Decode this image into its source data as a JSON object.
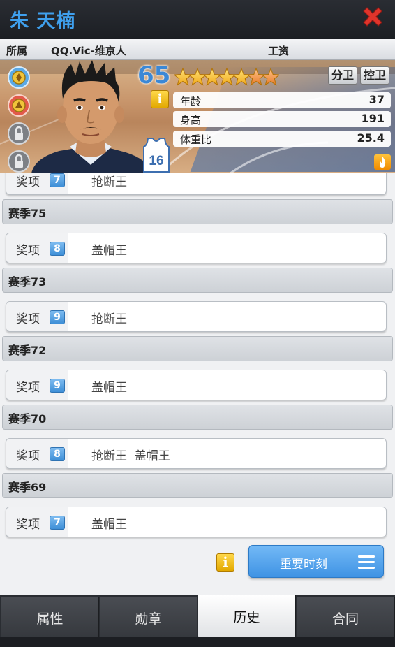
{
  "header": {
    "title": "朱 天楠"
  },
  "info_row": {
    "team_label": "所属",
    "team_value": "QQ.Vic-维京人",
    "salary_label": "工资"
  },
  "player": {
    "overall": "65",
    "stars": 5.5,
    "stars_max": 7,
    "positions": [
      "分卫",
      "控卫"
    ],
    "jersey_number": "16",
    "stats": [
      {
        "label": "年龄",
        "value": "37"
      },
      {
        "label": "身高",
        "value": "191"
      },
      {
        "label": "体重比",
        "value": "25.4"
      }
    ]
  },
  "history": {
    "award_label": "奖项",
    "rows": [
      {
        "kind": "award",
        "count": "7",
        "names": "抢断王"
      },
      {
        "kind": "season",
        "label": "赛季75"
      },
      {
        "kind": "award",
        "count": "8",
        "names": "盖帽王"
      },
      {
        "kind": "season",
        "label": "赛季73"
      },
      {
        "kind": "award",
        "count": "9",
        "names": "抢断王"
      },
      {
        "kind": "season",
        "label": "赛季72"
      },
      {
        "kind": "award",
        "count": "9",
        "names": "盖帽王"
      },
      {
        "kind": "season",
        "label": "赛季70"
      },
      {
        "kind": "award",
        "count": "8",
        "names": "抢断王  盖帽王"
      },
      {
        "kind": "season",
        "label": "赛季69"
      },
      {
        "kind": "award",
        "count": "7",
        "names": "盖帽王"
      }
    ]
  },
  "info_icon": "i",
  "important_button": {
    "label": "重要时刻"
  },
  "tabs": [
    {
      "label": "属性",
      "active": false
    },
    {
      "label": "勋章",
      "active": false
    },
    {
      "label": "历史",
      "active": true
    },
    {
      "label": "合同",
      "active": false
    }
  ],
  "colors": {
    "accent": "#3fa0ee",
    "close": "#e0342b",
    "star": "#f7c325",
    "button": "#4a9be8"
  }
}
